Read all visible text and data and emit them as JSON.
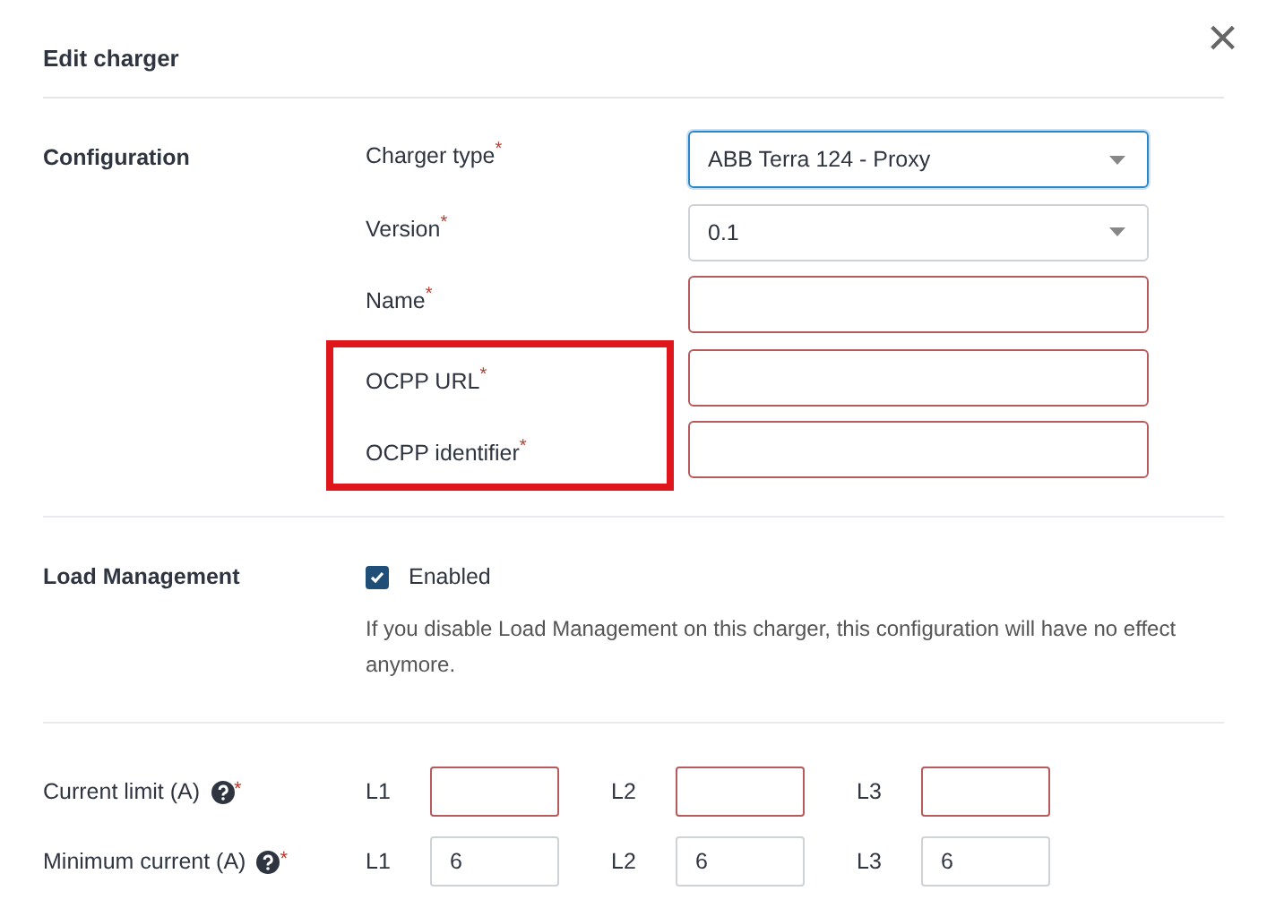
{
  "dialog": {
    "title": "Edit charger",
    "close": "×"
  },
  "configuration": {
    "heading": "Configuration",
    "fields": [
      {
        "label": "Charger type",
        "required_mark": "*",
        "kind": "select",
        "value": "ABB Terra 124 - Proxy",
        "focused": true,
        "invalid": false,
        "highlighted": false
      },
      {
        "label": "Version",
        "required_mark": "*",
        "kind": "select",
        "value": "0.1",
        "focused": false,
        "invalid": false,
        "highlighted": false
      },
      {
        "label": "Name",
        "required_mark": "*",
        "kind": "text",
        "focused": false,
        "invalid": true,
        "highlighted": false
      },
      {
        "label": "OCPP URL",
        "required_mark": "*",
        "kind": "text",
        "focused": false,
        "invalid": true,
        "highlighted": true
      },
      {
        "label": "OCPP identifier",
        "required_mark": "*",
        "kind": "text",
        "focused": false,
        "invalid": true,
        "highlighted": true
      }
    ]
  },
  "load_management": {
    "heading": "Load Management",
    "checkbox": {
      "label": "Enabled",
      "checked": true
    },
    "description": "If you disable Load Management on this charger, this configuration will have no effect anymore."
  },
  "currents": [
    {
      "label": "Current limit (A)",
      "required_mark": "*",
      "phases": [
        {
          "label": "L1",
          "invalid": true
        },
        {
          "label": "L2",
          "invalid": true
        },
        {
          "label": "L3",
          "invalid": true
        }
      ]
    },
    {
      "label": "Minimum current (A)",
      "required_mark": "*",
      "phases": [
        {
          "label": "L1",
          "value": "6",
          "invalid": false
        },
        {
          "label": "L2",
          "value": "6",
          "invalid": false
        },
        {
          "label": "L3",
          "value": "6",
          "invalid": false
        }
      ]
    }
  ]
}
